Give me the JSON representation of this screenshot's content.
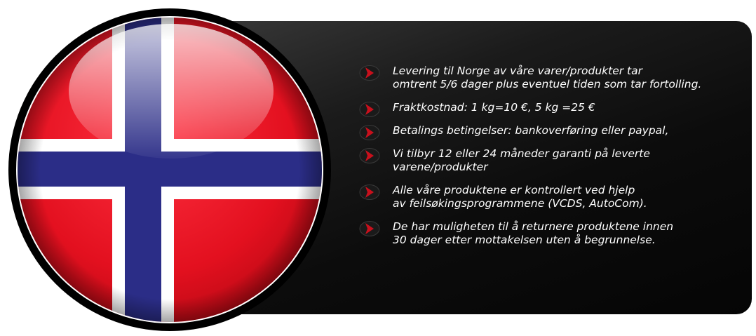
{
  "icons": {
    "bullet": "chevron-right-icon",
    "flag": "norway-flag-icon"
  },
  "colors": {
    "flag_red": "#e3101f",
    "flag_blue": "#2b2d87",
    "flag_white": "#ffffff",
    "bullet_red": "#c8101c",
    "panel_dark": "#0c0c0c",
    "text": "#ffffff"
  },
  "items": [
    {
      "text": "Levering til Norge av  våre varer/produkter tar\nomtrent 5/6 dager plus eventuel tiden som tar fortolling."
    },
    {
      "text": "Fraktkostnad: 1 kg=10 €, 5 kg =25 €"
    },
    {
      "text": "Betalings betingelser: bankoverføring  eller paypal,"
    },
    {
      "text": "Vi tilbyr 12 eller 24 måneder garanti på leverte\nvarene/produkter"
    },
    {
      "text": "Alle våre produktene er kontrollert ved hjelp\nav feilsøkingsprogrammene (VCDS, AutoCom)."
    },
    {
      "text": "De har muligheten til å returnere produktene innen\n30 dager etter mottakelsen uten å begrunnelse."
    }
  ]
}
